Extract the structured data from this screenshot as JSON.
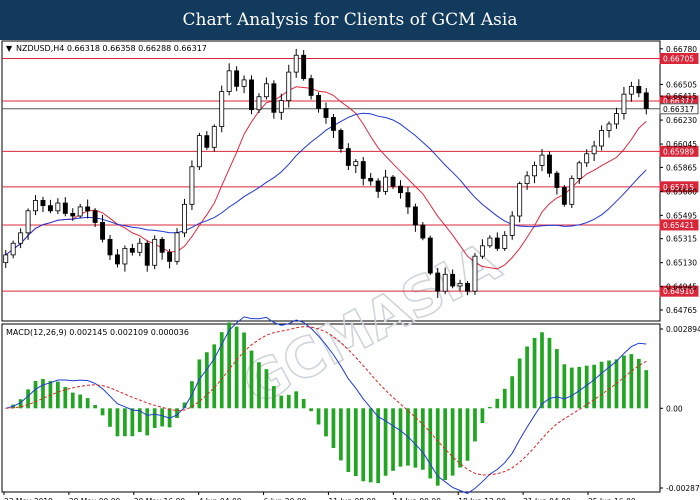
{
  "banner": {
    "title": "Chart Analysis for Clients of GCM Asia"
  },
  "colors": {
    "banner_bg": "#123a5c",
    "ma_fast": "#e0283c",
    "ma_slow": "#2236d8",
    "level": "#d8273a",
    "macd_line": "#1f3cd6",
    "signal": "#e02020",
    "hist": "#22a522"
  },
  "watermark": "GCMASIA",
  "chart_data": [
    {
      "type": "candlestick",
      "legend": "NZDUSD,H4  0.66318 0.66358 0.66288 0.66317",
      "ylim": [
        0.6468,
        0.6684
      ],
      "y_ticks": [
        "0.66780",
        "0.66505",
        "0.66415",
        "0.66230",
        "0.66045",
        "0.65865",
        "0.65680",
        "0.65495",
        "0.65315",
        "0.65130",
        "0.64945",
        "0.64765"
      ],
      "x_ticks": [
        "23 May 2019",
        "28 May 00:00",
        "30 May 16:00",
        "4 Jun 04:00",
        "6 Jun 20:00",
        "11 Jun 08:00",
        "14 Jun 00:00",
        "18 Jun 12:00",
        "21 Jun 04:00",
        "25 Jun 16:00"
      ],
      "levels": [
        "0.66705",
        "0.66377",
        "0.66317",
        "0.65989",
        "0.65715",
        "0.65421",
        "0.64910"
      ],
      "closes": [
        0.6519,
        0.6528,
        0.6536,
        0.6553,
        0.6561,
        0.6557,
        0.6553,
        0.6559,
        0.6551,
        0.6549,
        0.6556,
        0.6553,
        0.6544,
        0.6531,
        0.6519,
        0.6512,
        0.6524,
        0.6521,
        0.6528,
        0.6511,
        0.6531,
        0.6521,
        0.6514,
        0.6536,
        0.6558,
        0.6587,
        0.6611,
        0.6602,
        0.6618,
        0.6645,
        0.6661,
        0.6649,
        0.6654,
        0.6631,
        0.6641,
        0.6651,
        0.6629,
        0.6638,
        0.666,
        0.6673,
        0.6655,
        0.6642,
        0.6632,
        0.6625,
        0.6615,
        0.6601,
        0.6588,
        0.6591,
        0.6578,
        0.6576,
        0.6568,
        0.6579,
        0.6572,
        0.6567,
        0.6556,
        0.6542,
        0.6532,
        0.6505,
        0.6491,
        0.6504,
        0.6495,
        0.6497,
        0.6491,
        0.6518,
        0.6526,
        0.6532,
        0.6524,
        0.6534,
        0.6549,
        0.6574,
        0.658,
        0.6588,
        0.6596,
        0.6582,
        0.6571,
        0.6558,
        0.6578,
        0.659,
        0.6597,
        0.6603,
        0.6615,
        0.662,
        0.6628,
        0.6643,
        0.6649,
        0.6644,
        0.6632
      ]
    },
    {
      "type": "line",
      "legend": "MACD(12,26,9) 0.002145 0.002109 0.000036",
      "ylim": [
        -0.00287,
        0.00289
      ],
      "y_ticks": [
        "0.002894",
        "0.00",
        "-0.002871"
      ]
    }
  ]
}
